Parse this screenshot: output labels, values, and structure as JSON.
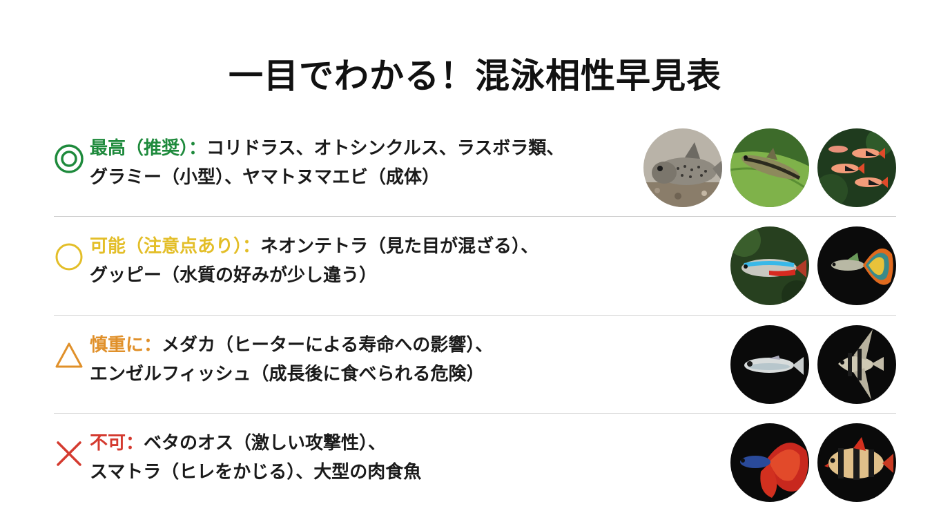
{
  "title": "一目でわかる！混泳相性早見表",
  "colors": {
    "best": "#1e8a3c",
    "caution": "#e3be28",
    "careful": "#e0902a",
    "ng": "#d43a2f",
    "divider": "#cfcfcf"
  },
  "rows": [
    {
      "symbol_icon": "double-circle-icon",
      "label": "最高（推奨）：",
      "line1": "コリドラス、オトシンクルス、ラスボラ類、",
      "line2": "グラミー（小型）、ヤマトヌマエビ（成体）",
      "photos": [
        "corydoras-photo",
        "otocinclus-photo",
        "rasbora-photo"
      ]
    },
    {
      "symbol_icon": "circle-icon",
      "label": "可能（注意点あり）：",
      "line1": "ネオンテトラ（見た目が混ざる）、",
      "line2": "グッピー（水質の好みが少し違う）",
      "photos": [
        "neon-tetra-photo",
        "guppy-photo"
      ]
    },
    {
      "symbol_icon": "triangle-icon",
      "label": "慎重に：",
      "line1": "メダカ（ヒーターによる寿命への影響）、",
      "line2": "エンゼルフィッシュ（成長後に食べられる危険）",
      "photos": [
        "medaka-photo",
        "angelfish-photo"
      ]
    },
    {
      "symbol_icon": "cross-icon",
      "label": "不可：",
      "line1": "ベタのオス（激しい攻撃性）、",
      "line2": "スマトラ（ヒレをかじる）、大型の肉食魚",
      "photos": [
        "betta-photo",
        "tiger-barb-photo"
      ]
    }
  ]
}
